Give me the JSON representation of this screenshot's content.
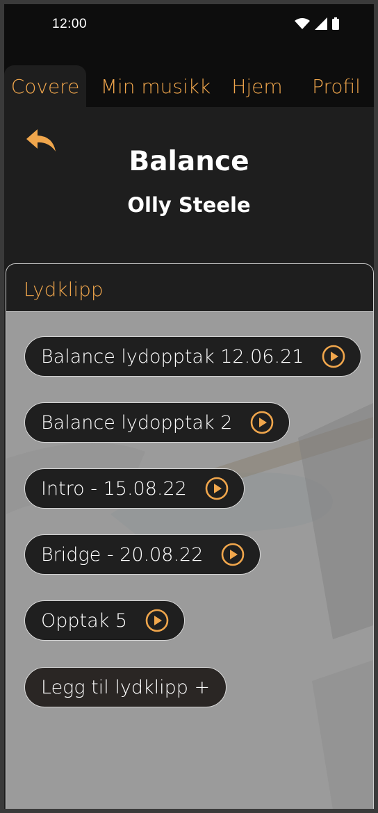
{
  "status": {
    "time": "12:00"
  },
  "tabs": [
    {
      "label": "Covere",
      "active": true
    },
    {
      "label": "Min musikk",
      "active": false
    },
    {
      "label": "Hjem",
      "active": false
    },
    {
      "label": "Profil",
      "active": false
    }
  ],
  "song": {
    "title": "Balance",
    "artist": "Olly Steele"
  },
  "section": {
    "title": "Lydklipp"
  },
  "clips": [
    {
      "label": "Balance lydopptak 12.06.21"
    },
    {
      "label": "Balance lydopptak 2"
    },
    {
      "label": "Intro - 15.08.22"
    },
    {
      "label": "Bridge - 20.08.22"
    },
    {
      "label": "Opptak 5"
    }
  ],
  "add_button": {
    "label": "Legg til lydklipp +"
  },
  "colors": {
    "accent": "#f0a64c",
    "dark": "#1e1e1e",
    "panel": "#9a9a9a"
  },
  "icons": {
    "back": "reply-arrow-icon",
    "play": "play-circle-icon"
  }
}
